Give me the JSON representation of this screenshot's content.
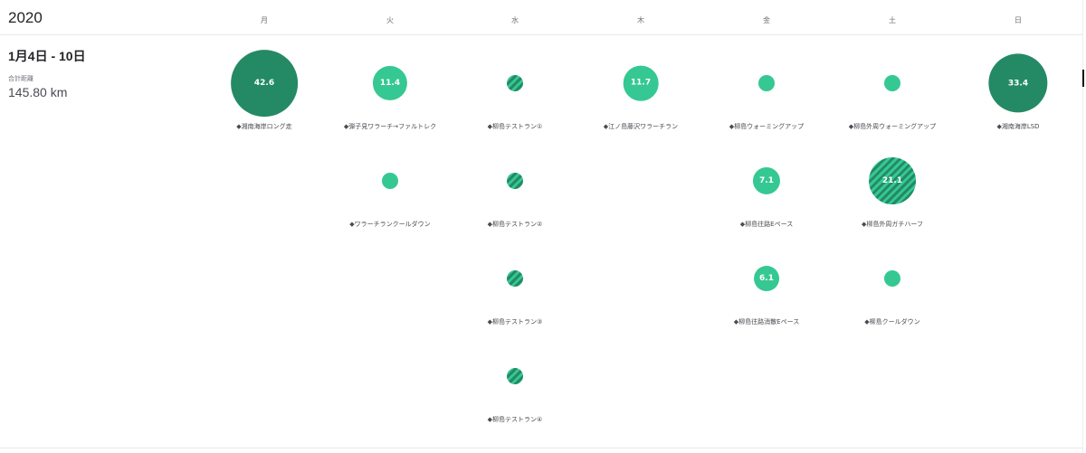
{
  "year": "2020",
  "days": [
    "月",
    "火",
    "水",
    "木",
    "金",
    "土",
    "日"
  ],
  "week": {
    "title": "1月4日 - 10日",
    "total_label": "合計距離",
    "total_value": "145.80 km"
  },
  "colors": {
    "light": "#35c893",
    "dark": "#248a66"
  },
  "activities": [
    {
      "day": 0,
      "row": 0,
      "value": "42.6",
      "distance_km": 42.6,
      "style": "dark",
      "label": "◆湘南海岸ロング走"
    },
    {
      "day": 1,
      "row": 0,
      "value": "11.4",
      "distance_km": 11.4,
      "style": "light",
      "label": "◆弾子見ワラーチ→ファルトレク"
    },
    {
      "day": 1,
      "row": 1,
      "value": "",
      "distance_km": 2,
      "style": "light",
      "label": "◆ワラーチランクールダウン"
    },
    {
      "day": 2,
      "row": 0,
      "value": "",
      "distance_km": 2,
      "style": "striped",
      "label": "◆柳島テストラン①"
    },
    {
      "day": 2,
      "row": 1,
      "value": "",
      "distance_km": 2,
      "style": "striped",
      "label": "◆柳島テストラン②"
    },
    {
      "day": 2,
      "row": 2,
      "value": "",
      "distance_km": 2,
      "style": "striped",
      "label": "◆柳島テストラン③"
    },
    {
      "day": 2,
      "row": 3,
      "value": "",
      "distance_km": 2,
      "style": "striped",
      "label": "◆柳島テストラン④"
    },
    {
      "day": 3,
      "row": 0,
      "value": "11.7",
      "distance_km": 11.7,
      "style": "light",
      "label": "◆江ノ島藤沢ワラーチラン"
    },
    {
      "day": 4,
      "row": 0,
      "value": "",
      "distance_km": 2,
      "style": "light",
      "label": "◆柳島ウォーミングアップ"
    },
    {
      "day": 4,
      "row": 1,
      "value": "7.1",
      "distance_km": 7.1,
      "style": "light",
      "label": "◆柳島往路Eペース"
    },
    {
      "day": 4,
      "row": 2,
      "value": "6.1",
      "distance_km": 6.1,
      "style": "light",
      "label": "◆柳島往路消散Eペース"
    },
    {
      "day": 5,
      "row": 0,
      "value": "",
      "distance_km": 2,
      "style": "light",
      "label": "◆柳島外周ウォーミングアップ"
    },
    {
      "day": 5,
      "row": 1,
      "value": "21.1",
      "distance_km": 21.1,
      "style": "striped",
      "label": "◆柳島外周ガチハーフ"
    },
    {
      "day": 5,
      "row": 2,
      "value": "",
      "distance_km": 2,
      "style": "light",
      "label": "◆柳島クールダウン"
    },
    {
      "day": 6,
      "row": 0,
      "value": "33.4",
      "distance_km": 33.4,
      "style": "dark",
      "label": "◆湘南海岸LSD"
    }
  ]
}
